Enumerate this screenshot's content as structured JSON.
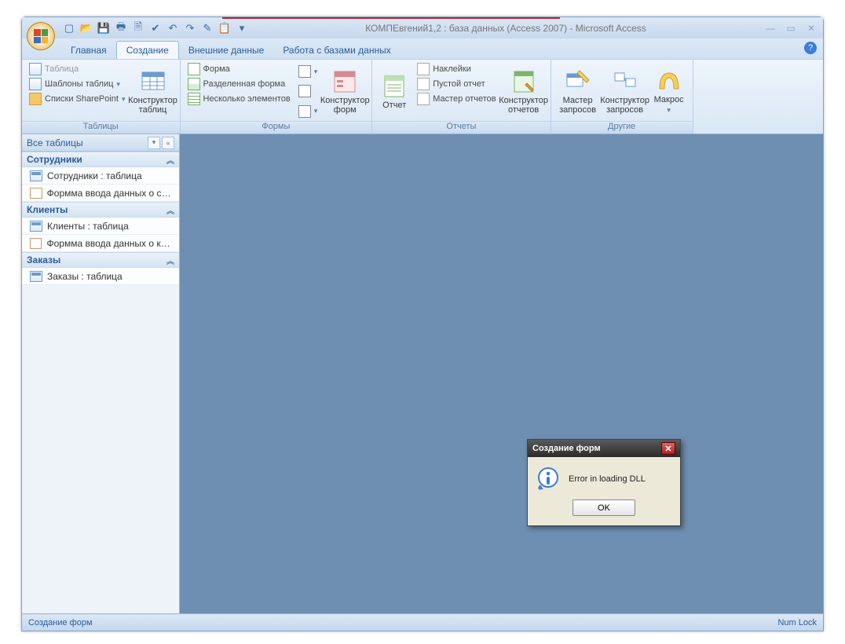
{
  "title": "КОМПЕвгений1,2 : база данных (Access 2007) - Microsoft Access",
  "tabs": {
    "t0": "Главная",
    "t1": "Создание",
    "t2": "Внешние данные",
    "t3": "Работа с базами данных"
  },
  "ribbon": {
    "grp_tables": "Таблицы",
    "grp_forms": "Формы",
    "grp_reports": "Отчеты",
    "grp_other": "Другие",
    "btn_table": "Таблица",
    "btn_tmpl": "Шаблоны таблиц",
    "btn_splist": "Списки SharePoint",
    "btn_tblcon": "Конструктор таблиц",
    "btn_form": "Форма",
    "btn_split": "Разделенная форма",
    "btn_multi": "Несколько элементов",
    "btn_frmcon": "Конструктор форм",
    "btn_report": "Отчет",
    "btn_labels": "Наклейки",
    "btn_blank": "Пустой отчет",
    "btn_rwiz": "Мастер отчетов",
    "btn_rcon": "Конструктор отчетов",
    "btn_qwiz": "Мастер запросов",
    "btn_qcon": "Конструктор запросов",
    "btn_macro": "Макрос"
  },
  "nav": {
    "header": "Все таблицы",
    "g1": "Сотрудники",
    "g1i1": "Сотрудники : таблица",
    "g1i2": "Формма ввода данных о сот...",
    "g2": "Клиенты",
    "g2i1": "Клиенты : таблица",
    "g2i2": "Формма ввода данных о кли...",
    "g3": "Заказы",
    "g3i1": "Заказы : таблица"
  },
  "dialog": {
    "title": "Создание форм",
    "message": "Error in loading DLL",
    "ok": "OK"
  },
  "status": {
    "left": "Создание форм",
    "right": "Num Lock"
  }
}
